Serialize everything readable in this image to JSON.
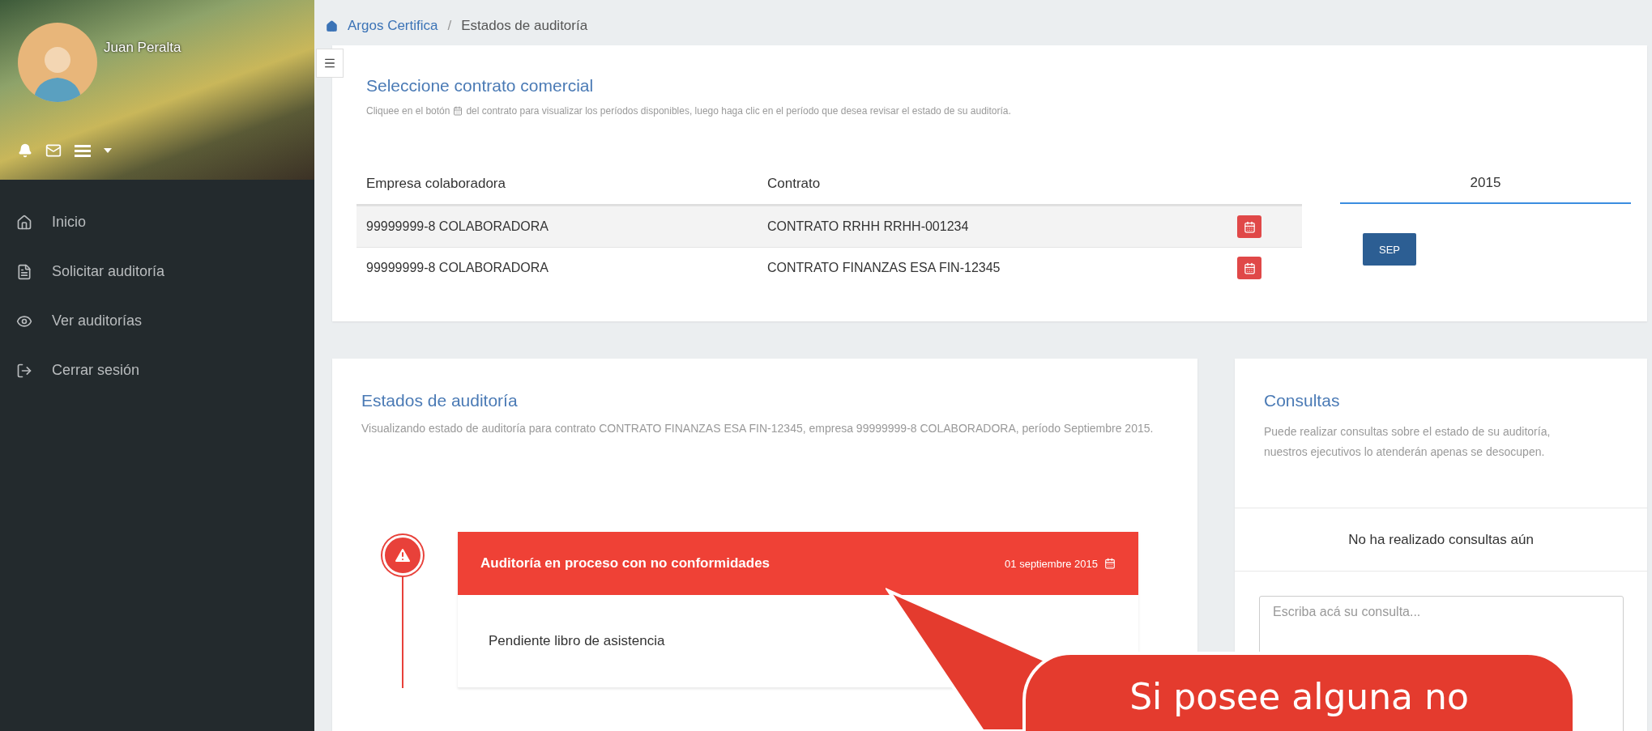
{
  "sidebar": {
    "user_name": "Juan Peralta",
    "nav": [
      {
        "label": "Inicio"
      },
      {
        "label": "Solicitar auditoría"
      },
      {
        "label": "Ver auditorías"
      },
      {
        "label": "Cerrar sesión"
      }
    ]
  },
  "breadcrumb": [
    {
      "label": "Argos Certifica"
    },
    {
      "label": "Estados de auditoría"
    }
  ],
  "breadcrumb_separator": "/",
  "contract_card": {
    "title": "Seleccione contrato comercial",
    "description_start": "Cliquee en el botón",
    "description_end": "del contrato para visualizar los períodos disponibles, luego haga clic en el período que desea revisar el estado de su auditoría.",
    "columns": [
      "Empresa colaboradora",
      "Contrato"
    ],
    "rows": [
      {
        "company": "99999999-8 COLABORADORA",
        "contract": "CONTRATO RRHH RRHH-001234"
      },
      {
        "company": "99999999-8 COLABORADORA",
        "contract": "CONTRATO FINANZAS ESA FIN-12345"
      }
    ],
    "year": "2015",
    "months": [
      "SEP"
    ]
  },
  "status_card": {
    "title": "Estados de auditoría",
    "description": "Visualizando estado de auditoría para contrato CONTRATO FINANZAS ESA FIN-12345, empresa 99999999-8 COLABORADORA, período Septiembre 2015.",
    "timeline": [
      {
        "title": "Auditoría en proceso con no conformidades",
        "date": "01 septiembre 2015",
        "items": [
          "Pendiente libro de asistencia"
        ]
      }
    ]
  },
  "queries_card": {
    "title": "Consultas",
    "description": "Puede realizar consultas sobre el estado de su auditoría, nuestros ejecutivos lo atenderán apenas se desocupen.",
    "empty_message": "No ha realizado consultas aún",
    "placeholder": "Escriba acá su consulta..."
  },
  "callout": {
    "text": "Si posee alguna no"
  }
}
